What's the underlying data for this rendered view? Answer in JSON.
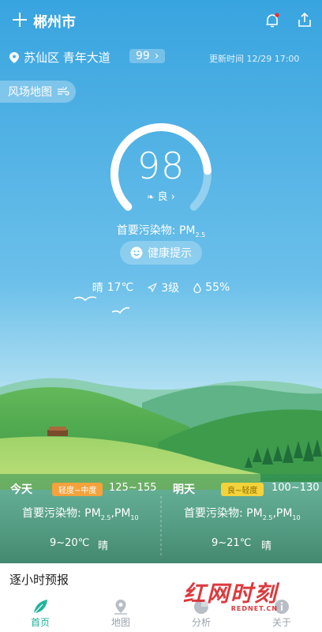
{
  "header": {
    "city": "郴州市"
  },
  "location": {
    "district": "苏仙区 青年大道",
    "aqi_pill": "99",
    "updated": "更新时间 12/29 17:00"
  },
  "wind_map": {
    "label": "风场地图"
  },
  "aqi": {
    "value": "98",
    "level": "良",
    "primary_pollutant_label": "首要污染物:",
    "primary_pollutant": "PM",
    "primary_pollutant_sub": "2.5",
    "gauge_fraction": 0.82
  },
  "health_tip": {
    "label": "健康提示"
  },
  "conditions": {
    "weather": "晴",
    "temp": "17℃",
    "wind": "3级",
    "humidity": "55%"
  },
  "forecast": {
    "today": {
      "label": "今天",
      "badge": "轻度~中度",
      "range": "125~155",
      "pollutant_label": "首要污染物:",
      "p1": "PM",
      "p1_sub": "2.5",
      "p2": "PM",
      "p2_sub": "10",
      "temp": "9~20℃",
      "weather": "晴"
    },
    "tomorrow": {
      "label": "明天",
      "badge": "良~轻度",
      "range": "100~130",
      "pollutant_label": "首要污染物:",
      "p1": "PM",
      "p1_sub": "2.5",
      "p2": "PM",
      "p2_sub": "10",
      "temp": "9~21℃",
      "weather": "晴"
    }
  },
  "hourly": {
    "title": "逐小时预报"
  },
  "nav": [
    {
      "label": "首页",
      "icon": "leaf-icon"
    },
    {
      "label": "地图",
      "icon": "map-pin-icon"
    },
    {
      "label": "分析",
      "icon": "pie-chart-icon"
    },
    {
      "label": "关于",
      "icon": "info-icon"
    }
  ],
  "watermark": {
    "text": "红网时刻",
    "sub": "REDNET.CN"
  },
  "colors": {
    "sky_top": "#3aa6e0",
    "sky_bottom": "#a8dcef",
    "active_nav": "#23b39b",
    "badge_today": "#f4a23b",
    "badge_tomorrow": "#f4d23b"
  }
}
